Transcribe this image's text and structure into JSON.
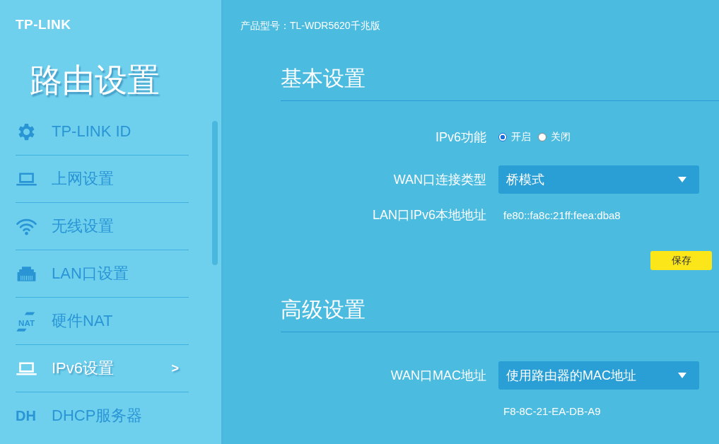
{
  "logo": "TP-LINK",
  "sidebar": {
    "title": "路由设置",
    "items": [
      {
        "label": "TP-LINK ID",
        "kind": "gear",
        "selected": false
      },
      {
        "label": "上网设置",
        "kind": "laptop",
        "selected": false
      },
      {
        "label": "无线设置",
        "kind": "wifi",
        "selected": false
      },
      {
        "label": "LAN口设置",
        "kind": "port",
        "selected": false
      },
      {
        "label": "硬件NAT",
        "kind": "nat",
        "selected": false,
        "icon_text": "NAT"
      },
      {
        "label": "IPv6设置",
        "kind": "laptop",
        "selected": true,
        "chevron": ">"
      },
      {
        "label": "DHCP服务器",
        "kind": "dhcp",
        "selected": false,
        "icon_text": "DH"
      }
    ]
  },
  "product_model": "产品型号：TL-WDR5620千兆版",
  "sections": [
    {
      "title": "基本设置",
      "fields": [
        {
          "kind": "radio",
          "label": "IPv6功能",
          "options": [
            {
              "label": "开启",
              "selected": true
            },
            {
              "label": "关闭",
              "selected": false
            }
          ]
        },
        {
          "kind": "select",
          "label": "WAN口连接类型",
          "value": "桥模式"
        },
        {
          "kind": "text",
          "label": "LAN口IPv6本地地址",
          "value": "fe80::fa8c:21ff:feea:dba8"
        }
      ],
      "button": "保存"
    },
    {
      "title": "高级设置",
      "fields": [
        {
          "kind": "select",
          "label": "WAN口MAC地址",
          "value": "使用路由器的MAC地址"
        },
        {
          "kind": "text",
          "value": "F8-8C-21-EA-DB-A9"
        }
      ]
    }
  ]
}
